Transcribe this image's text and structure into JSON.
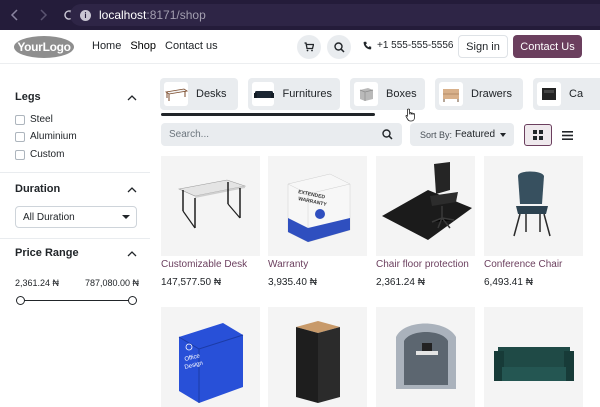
{
  "browser": {
    "url_host": "localhost",
    "url_rest": ":8171/shop"
  },
  "header": {
    "logo_text_1": "Your",
    "logo_text_2": "Logo",
    "nav": [
      "Home",
      "Shop",
      "Contact us"
    ],
    "phone": "+1 555-555-5556",
    "signin_label": "Sign in",
    "contact_label": "Contact Us"
  },
  "filters": {
    "legs": {
      "title": "Legs",
      "options": [
        "Steel",
        "Aluminium",
        "Custom"
      ]
    },
    "duration": {
      "title": "Duration",
      "selected": "All Duration"
    },
    "price_range": {
      "title": "Price Range",
      "min_label": "2,361.24 ₦",
      "max_label": "787,080.00 ₦",
      "min_fraction": 0.0,
      "max_fraction": 1.0
    }
  },
  "categories": [
    "Desks",
    "Furnitures",
    "Boxes",
    "Drawers",
    "Ca"
  ],
  "toolbar": {
    "search_placeholder": "Search...",
    "sort_prefix": "Sort By:",
    "sort_value": "Featured"
  },
  "products": [
    {
      "name": "Customizable Desk",
      "price": "147,577.50 ₦"
    },
    {
      "name": "Warranty",
      "price": "3,935.40 ₦"
    },
    {
      "name": "Chair floor protection",
      "price": "2,361.24 ₦"
    },
    {
      "name": "Conference Chair",
      "price": "6,493.41 ₦"
    }
  ],
  "warranty_box_text": [
    "EXTENDED",
    "WARRANTY"
  ],
  "office_box_text": [
    "Office",
    "Design"
  ],
  "colors": {
    "accent": "#6b3f5e",
    "browser_bar": "#241c3a"
  }
}
